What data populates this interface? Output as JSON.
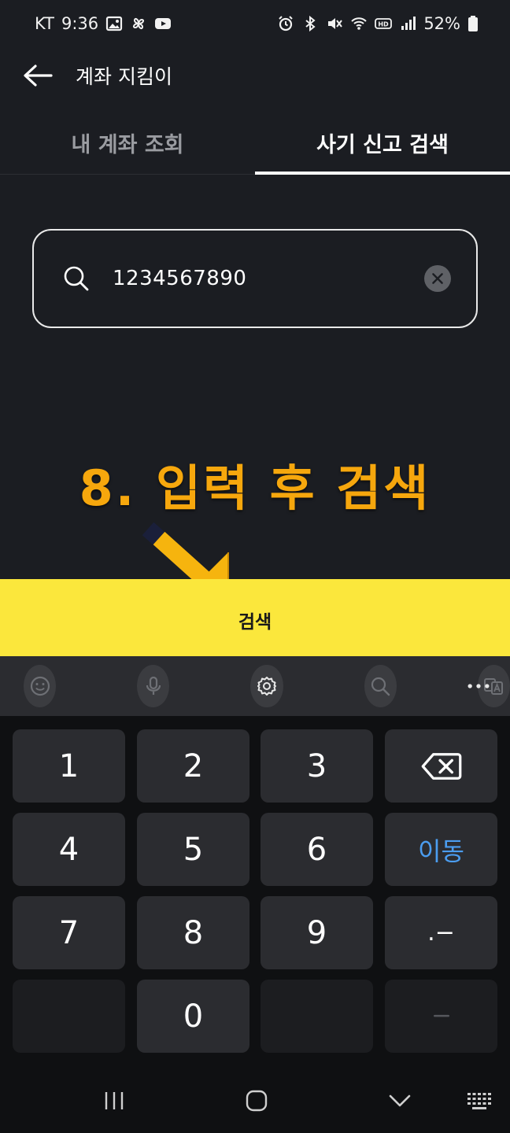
{
  "status_bar": {
    "carrier": "KT",
    "time": "9:36",
    "battery": "52%",
    "left_icons": [
      "gallery-icon",
      "pinwheel-icon",
      "youtube-icon"
    ],
    "right_icons": [
      "alarm-icon",
      "bluetooth-icon",
      "mute-icon",
      "wifi-icon",
      "hd-icon",
      "signal-icon",
      "battery-icon"
    ]
  },
  "app_bar": {
    "title": "계좌 지킴이"
  },
  "tabs": [
    {
      "label": "내 계좌 조회",
      "active": false
    },
    {
      "label": "사기 신고 검색",
      "active": true
    }
  ],
  "search": {
    "value": "1234567890"
  },
  "annotation": {
    "text": "8. 입력 후 검색",
    "color": "#f6a70d"
  },
  "search_button": {
    "label": "검색",
    "color": "#fbe73c"
  },
  "keyboard_toolbar": {
    "tools": [
      "emoji-icon",
      "microphone-icon",
      "settings-icon",
      "search-icon",
      "translate-icon"
    ],
    "more": "more-icon"
  },
  "keyboard": {
    "keys": {
      "k1": "1",
      "k2": "2",
      "k3": "3",
      "k4": "4",
      "k5": "5",
      "k6": "6",
      "k7": "7",
      "k8": "8",
      "k9": "9",
      "k0": "0",
      "move": "이동",
      "punct": ".−"
    },
    "accent_color": "#4b9df0"
  },
  "nav_bar": {
    "buttons": [
      "recents-icon",
      "home-icon",
      "back-icon",
      "keyboard-icon"
    ]
  }
}
